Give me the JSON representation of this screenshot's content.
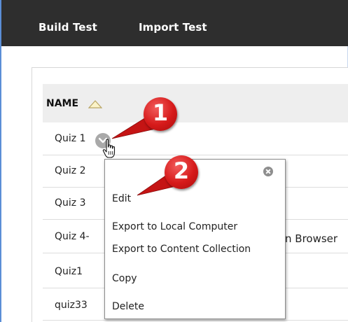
{
  "toolbar": {
    "build_test": "Build Test",
    "import_test": "Import Test"
  },
  "table": {
    "header_name": "NAME",
    "sort_icon": "sort-ascending-triangle",
    "rows": [
      "Quiz 1",
      "Quiz 2",
      "Quiz 3",
      "Quiz 4-",
      "Quiz1",
      "quiz33"
    ],
    "row4_extra": "n Browser"
  },
  "context_menu": {
    "items": [
      "Edit",
      "Export to Local Computer",
      "Export to Content Collection",
      "Copy",
      "Delete"
    ]
  },
  "callouts": {
    "one": "1",
    "two": "2"
  },
  "colors": {
    "toolbar_bg": "#2e2e2e",
    "header_row_bg": "#eeeeee",
    "callout_red": "#d61a1a",
    "frame_blue": "#5b8ed6"
  }
}
